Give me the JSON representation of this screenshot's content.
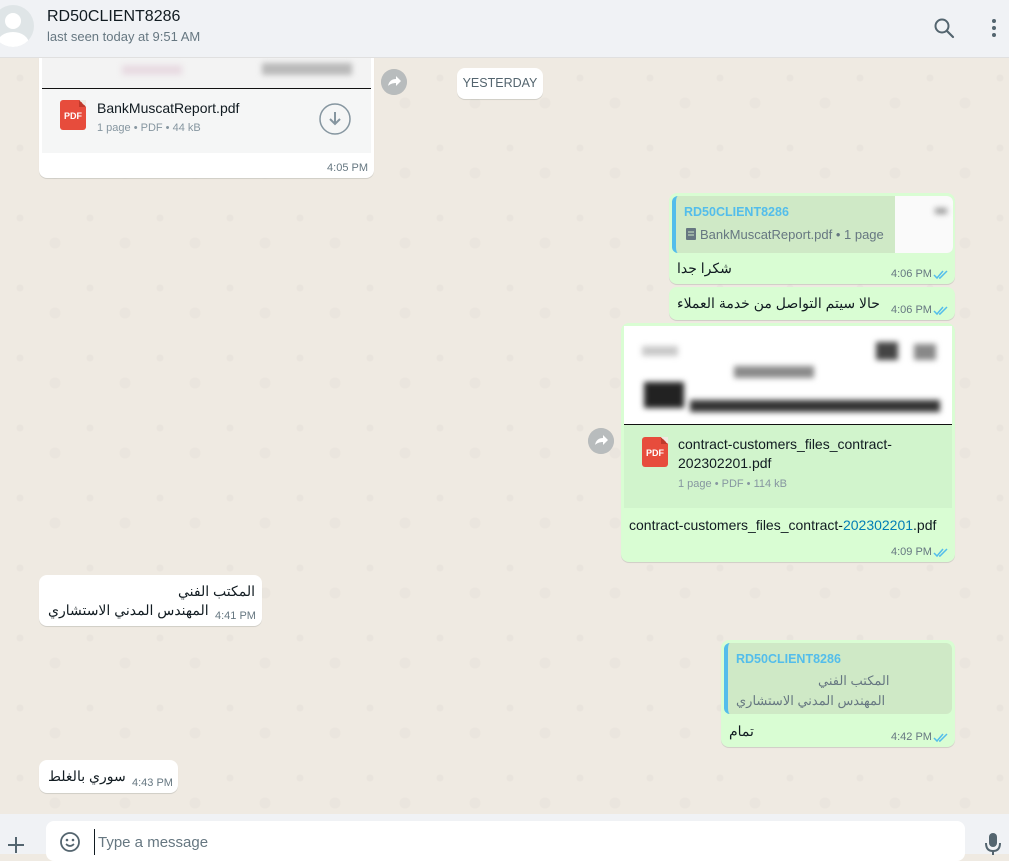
{
  "header": {
    "contact_name": "RD50CLIENT8286",
    "status": "last seen today at 9:51 AM",
    "search_icon": "search-icon",
    "menu_icon": "menu-icon"
  },
  "date_divider": "YESTERDAY",
  "messages": [
    {
      "direction": "in",
      "type": "document",
      "file_name": "BankMuscatReport.pdf",
      "file_icon_label": "PDF",
      "meta": "1 page • PDF • 44 kB",
      "time": "4:05 PM"
    },
    {
      "direction": "out",
      "type": "reply",
      "quote_author": "RD50CLIENT8286",
      "quote_text": "BankMuscatReport.pdf • 1 page",
      "text": "شكرا جدا",
      "time": "4:06 PM"
    },
    {
      "direction": "out",
      "type": "text",
      "text": "حالا سيتم التواصل من خدمة العملاء",
      "time": "4:06 PM"
    },
    {
      "direction": "out",
      "type": "document",
      "file_name_line1": "contract-customers_files_contract-",
      "file_name_line2": "202302201.pdf",
      "file_icon_label": "PDF",
      "meta": "1 page • PDF • 114 kB",
      "caption_prefix": "contract-customers_files_contract-",
      "caption_link": "202302201",
      "caption_suffix": ".pdf",
      "time": "4:09 PM"
    },
    {
      "direction": "in",
      "type": "text",
      "line1": "المكتب الفني",
      "line2": "المهندس المدني الاستشاري",
      "time": "4:41 PM"
    },
    {
      "direction": "out",
      "type": "reply",
      "quote_author": "RD50CLIENT8286",
      "quote_line1": "المكتب الفني",
      "quote_line2": "المهندس المدني الاستشاري",
      "text": "تمام",
      "time": "4:42 PM"
    },
    {
      "direction": "in",
      "type": "text",
      "text": "سوري بالغلط",
      "time": "4:43 PM"
    }
  ],
  "composer": {
    "placeholder": "Type a message",
    "attach_icon": "plus-icon",
    "emoji_icon": "emoji-icon",
    "mic_icon": "mic-icon"
  },
  "colors": {
    "incoming_bubble": "#ffffff",
    "outgoing_bubble": "#d9fdd3",
    "read_ticks": "#53bdeb",
    "chat_background": "#efeae2"
  }
}
